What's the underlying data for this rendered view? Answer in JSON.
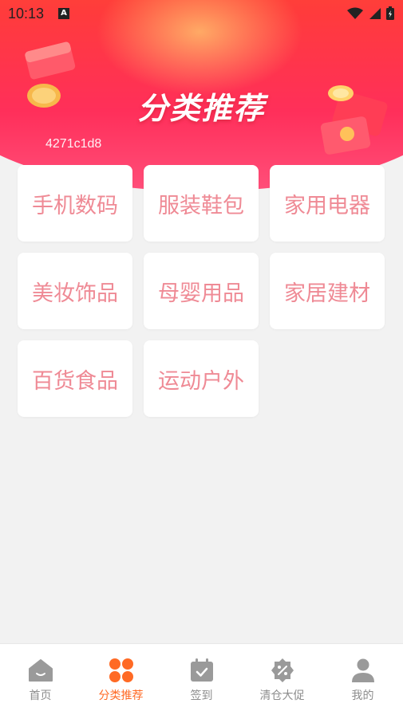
{
  "status": {
    "time": "10:13",
    "app_icon": "A"
  },
  "header": {
    "title": "分类推荐",
    "code": "4271c1d8"
  },
  "categories": [
    {
      "label": "手机数码"
    },
    {
      "label": "服装鞋包"
    },
    {
      "label": "家用电器"
    },
    {
      "label": "美妆饰品"
    },
    {
      "label": "母婴用品"
    },
    {
      "label": "家居建材"
    },
    {
      "label": "百货食品"
    },
    {
      "label": "运动户外"
    }
  ],
  "tabbar": {
    "items": [
      {
        "label": "首页",
        "icon": "home-icon"
      },
      {
        "label": "分类推荐",
        "icon": "category-grid-icon",
        "active": true
      },
      {
        "label": "签到",
        "icon": "calendar-check-icon"
      },
      {
        "label": "清仓大促",
        "icon": "discount-badge-icon"
      },
      {
        "label": "我的",
        "icon": "user-icon"
      }
    ]
  },
  "colors": {
    "accent": "#ff6a25",
    "card_text": "#ef8a95",
    "tab_inactive": "#8d8d8d",
    "background": "#f2f2f2"
  }
}
